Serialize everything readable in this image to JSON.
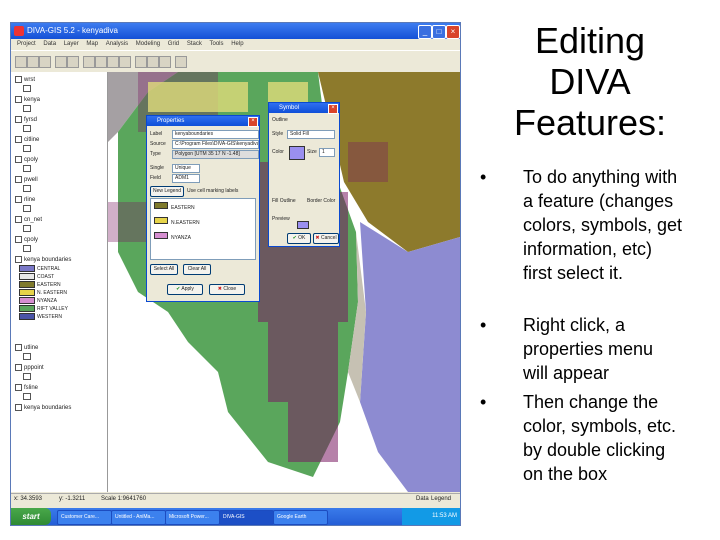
{
  "slide": {
    "title": "Editing DIVA Features:",
    "bullets": [
      "To do anything with a feature (changes colors, symbols, get information, etc) first select it.",
      "Right click, a properties menu will appear",
      "Then change the color, symbols, etc. by double clicking on the box"
    ],
    "bullet_char": "•"
  },
  "window": {
    "title": "DIVA-GIS 5.2 - kenyadiva",
    "menu": [
      "Project",
      "Data",
      "Layer",
      "Map",
      "Analysis",
      "Modeling",
      "Grid",
      "Stack",
      "Tools",
      "Help"
    ],
    "controls": [
      "_",
      "□",
      "×"
    ]
  },
  "layers": [
    {
      "name": "wrst"
    },
    {
      "name": "kenya"
    },
    {
      "name": "fyrsd"
    },
    {
      "name": "citline"
    },
    {
      "name": "cpoly"
    },
    {
      "name": "pwell"
    },
    {
      "name": "rline"
    },
    {
      "name": "cn_net"
    },
    {
      "name": "cpoly"
    },
    {
      "name": "kenya boundaries"
    }
  ],
  "legend": [
    {
      "label": "CENTRAL",
      "color": "#7a78c8"
    },
    {
      "label": "COAST",
      "color": "#e8e8e8"
    },
    {
      "label": "EASTERN",
      "color": "#7f7a2c"
    },
    {
      "label": "N. EASTERN",
      "color": "#e6d44a"
    },
    {
      "label": "NYANZA",
      "color": "#d58ed0"
    },
    {
      "label": "RIFT VALLEY",
      "color": "#5aa65c"
    },
    {
      "label": "WESTERN",
      "color": "#4a54a8"
    }
  ],
  "layers_lower": [
    {
      "name": "utline"
    },
    {
      "name": "pppoint"
    },
    {
      "name": "fsline"
    },
    {
      "name": "kenya boundaries"
    }
  ],
  "properties_dialog": {
    "title": "Properties",
    "label_caption": "Label",
    "label_value": "kenyaboundaries",
    "source_caption": "Source",
    "source_value": "C:\\Program Files\\DIVA-GIS\\kenyadiva\\kenya...",
    "type_caption": "Type",
    "type_value": "Polygon [UTM 35 17 N -1.48]",
    "single_caption": "Single",
    "single_value": "Unique",
    "field_caption": "Field",
    "field_value": "ADM1",
    "new_legend": "New Legend",
    "use_text": "Use cell marking labels",
    "classes": [
      "EASTERN",
      "N.EASTERN",
      "NYANZA"
    ],
    "class_colors": [
      "#7f7a2c",
      "#e6d44a",
      "#d58ed0"
    ],
    "select_all": "Select All",
    "clear_all": "Clear All",
    "apply": "Apply",
    "close": "Close"
  },
  "symbol_dialog": {
    "title": "Symbol",
    "section": "Outline",
    "style_caption": "Style",
    "style_value": "Solid Fill",
    "color_caption": "Color",
    "size_caption": "Size",
    "size_value": "1",
    "fill_caption": "Fill Outline",
    "border_caption": "Border Color",
    "preview_caption": "Preview",
    "ok": "OK",
    "cancel": "Cancel",
    "fill_color": "#9a8ff0"
  },
  "status": {
    "x": "x: 34.3593",
    "y": "y: -1.3211",
    "scale": "Scale 1:9641760",
    "tab1": "Data",
    "tab2": "Legend"
  },
  "taskbar": {
    "start": "start",
    "tasks": [
      "Customer Care...",
      "Untitled - AniMa...",
      "Microsoft Power...",
      "DIVA-GIS",
      "Google Earth"
    ],
    "clock": "11:53 AM"
  },
  "colors": {
    "green_region": "#5aa65c",
    "olive_region": "#8d7a2c",
    "lavender_region": "#8d8bd1",
    "gray_region": "#a5a0a3",
    "points": "#7a1a62"
  }
}
